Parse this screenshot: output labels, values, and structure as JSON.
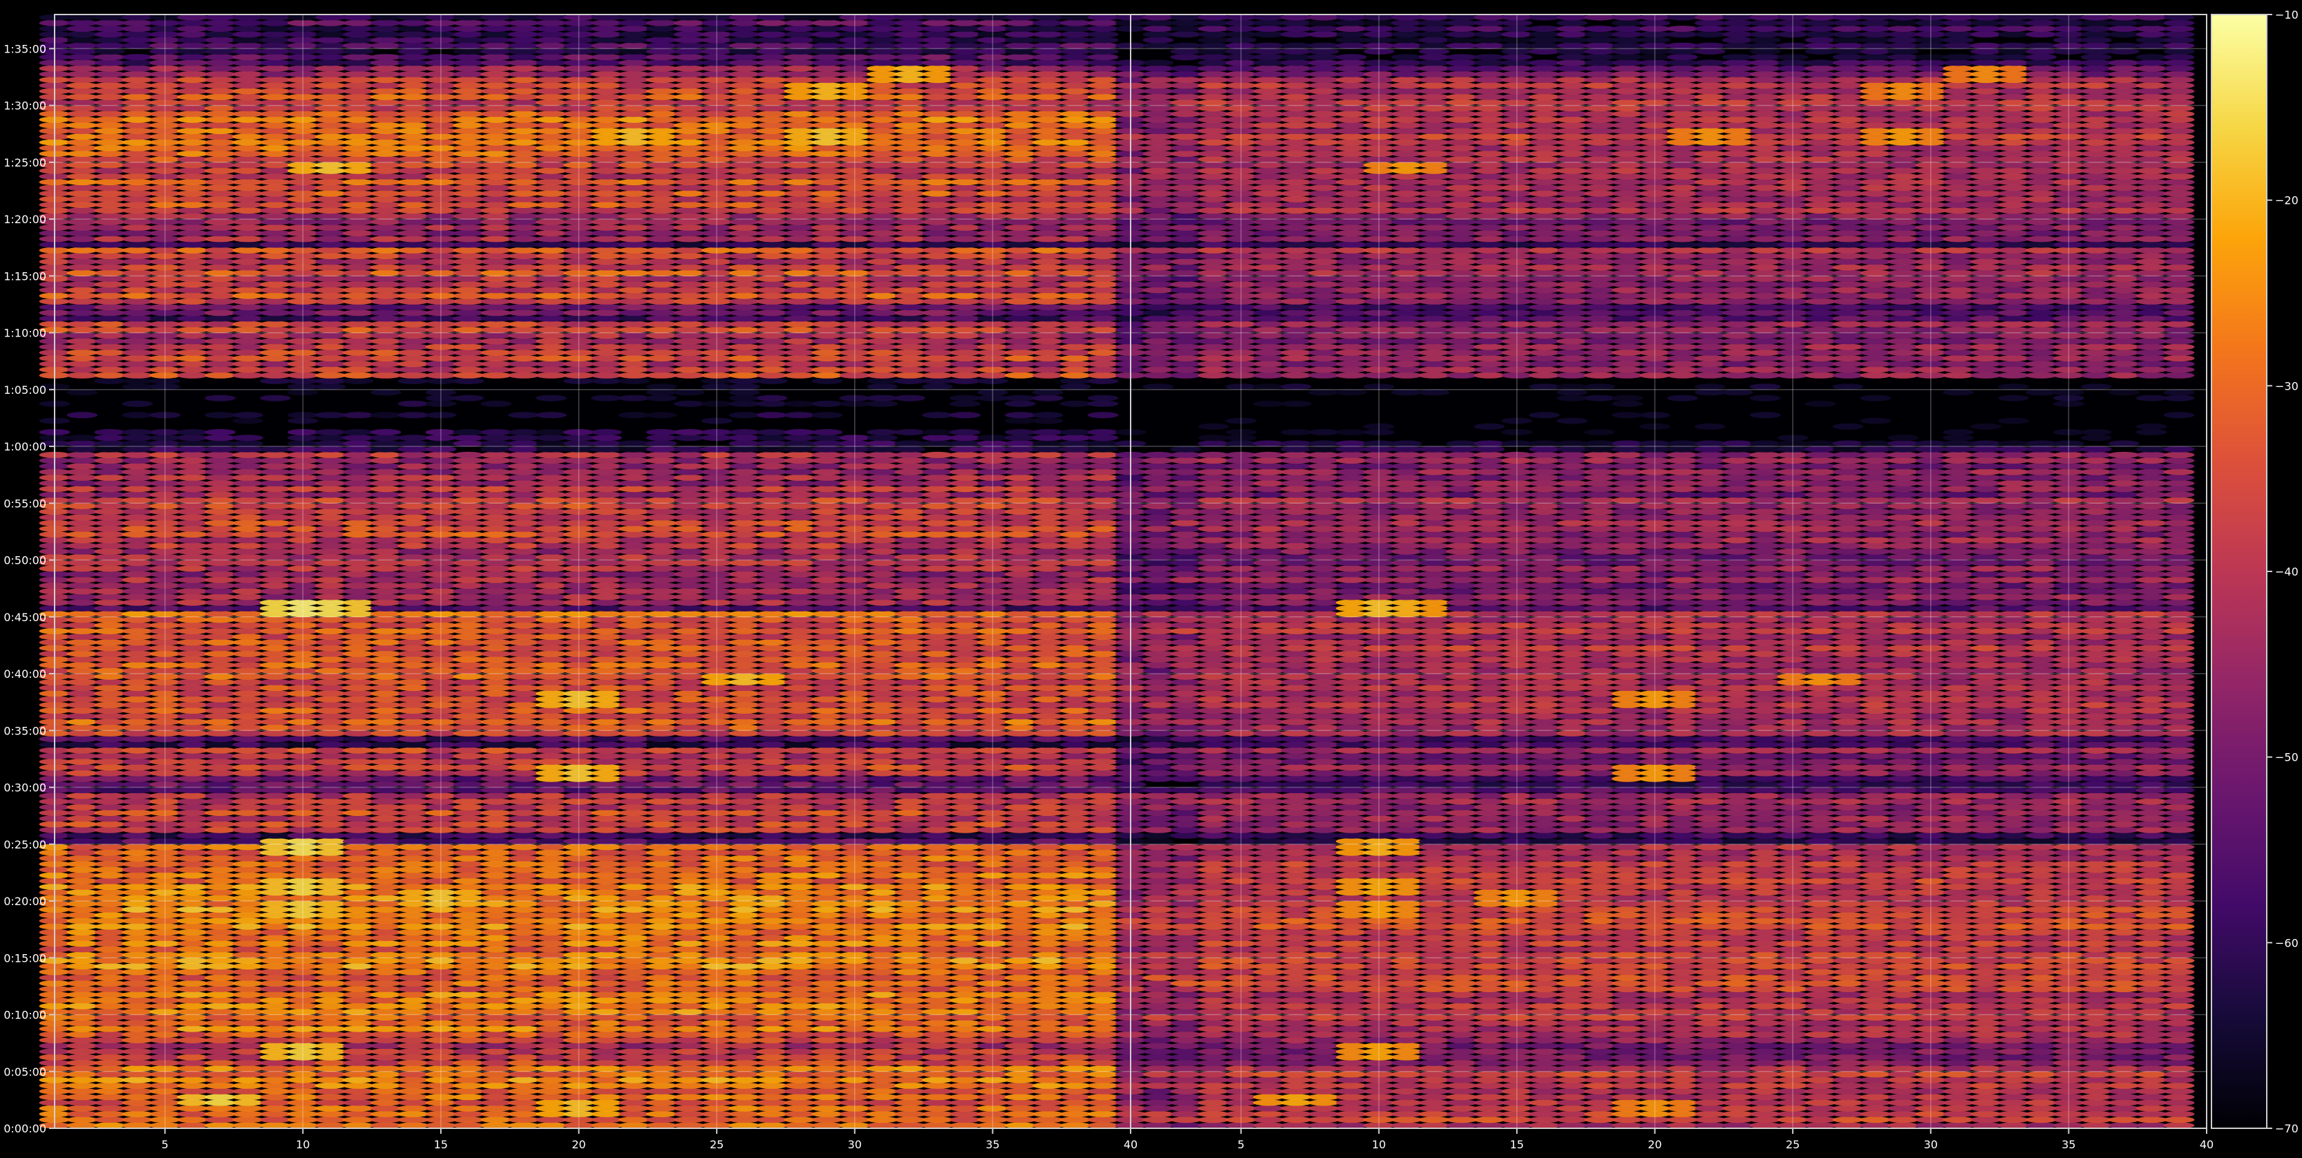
{
  "chart_data": {
    "type": "heatmap",
    "title": "",
    "xlabel": "",
    "ylabel": "",
    "colormap": "inferno",
    "background": "#000000",
    "grid": true,
    "panels": [
      {
        "name": "",
        "xlim": [
          1,
          40
        ],
        "xticks": [
          5,
          10,
          15,
          20,
          25,
          30,
          35,
          40
        ],
        "xticklabels": [
          "5",
          "10",
          "15",
          "20",
          "25",
          "30",
          "35",
          "40"
        ],
        "channel_range": [
          1,
          39
        ],
        "brightness": 1.0
      },
      {
        "name": "",
        "xlim": [
          1,
          40
        ],
        "xticks": [
          5,
          10,
          15,
          20,
          25,
          30,
          35,
          40
        ],
        "xticklabels": [
          "5",
          "10",
          "15",
          "20",
          "25",
          "30",
          "35",
          "40"
        ],
        "channel_range": [
          1,
          39
        ],
        "brightness": 0.78
      }
    ],
    "y_time_seconds_range": [
      0,
      5880
    ],
    "yticks_seconds": [
      0,
      300,
      600,
      900,
      1200,
      1500,
      1800,
      2100,
      2400,
      2700,
      3000,
      3300,
      3600,
      3900,
      4200,
      4500,
      4800,
      5100,
      5400,
      5700
    ],
    "yticklabels": [
      "0:00:00",
      "0:05:00",
      "0:10:00",
      "0:15:00",
      "0:20:00",
      "0:25:00",
      "0:30:00",
      "0:35:00",
      "0:40:00",
      "0:45:00",
      "0:50:00",
      "0:55:00",
      "1:00:00",
      "1:05:00",
      "1:10:00",
      "1:15:00",
      "1:20:00",
      "1:25:00",
      "1:30:00",
      "1:35:00"
    ],
    "colorbar": {
      "range": [
        -70,
        -10
      ],
      "ticks": [
        -10,
        -20,
        -30,
        -40,
        -50,
        -60,
        -70
      ],
      "ticklabels": [
        "−10",
        "−20",
        "−30",
        "−40",
        "−50",
        "−60",
        "−70"
      ],
      "label": ""
    },
    "bands": [
      {
        "t0": 0,
        "t1": 330,
        "level": -30
      },
      {
        "t0": 330,
        "t1": 490,
        "level": -40
      },
      {
        "t0": 490,
        "t1": 720,
        "level": -30
      },
      {
        "t0": 720,
        "t1": 1050,
        "level": -28
      },
      {
        "t0": 1050,
        "t1": 1350,
        "level": -27
      },
      {
        "t0": 1350,
        "t1": 1490,
        "level": -32
      },
      {
        "t0": 1490,
        "t1": 1560,
        "level": -55
      },
      {
        "t0": 1560,
        "t1": 1780,
        "level": -38
      },
      {
        "t0": 1780,
        "t1": 1860,
        "level": -55
      },
      {
        "t0": 1860,
        "t1": 2020,
        "level": -40
      },
      {
        "t0": 2020,
        "t1": 2080,
        "level": -56
      },
      {
        "t0": 2080,
        "t1": 2400,
        "level": -34
      },
      {
        "t0": 2400,
        "t1": 2720,
        "level": -32
      },
      {
        "t0": 2720,
        "t1": 2760,
        "level": -56
      },
      {
        "t0": 2760,
        "t1": 3080,
        "level": -42
      },
      {
        "t0": 3080,
        "t1": 3340,
        "level": -38
      },
      {
        "t0": 3340,
        "t1": 3580,
        "level": -42
      },
      {
        "t0": 3580,
        "t1": 3640,
        "level": -60
      },
      {
        "t0": 3640,
        "t1": 3700,
        "level": -66
      },
      {
        "t0": 3700,
        "t1": 3950,
        "level": -70
      },
      {
        "t0": 3950,
        "t1": 4270,
        "level": -38
      },
      {
        "t0": 4270,
        "t1": 4350,
        "level": -55
      },
      {
        "t0": 4350,
        "t1": 4640,
        "level": -36
      },
      {
        "t0": 4640,
        "t1": 4690,
        "level": -55
      },
      {
        "t0": 4690,
        "t1": 4830,
        "level": -44
      },
      {
        "t0": 4830,
        "t1": 5080,
        "level": -34
      },
      {
        "t0": 5080,
        "t1": 5340,
        "level": -31
      },
      {
        "t0": 5340,
        "t1": 5540,
        "level": -35
      },
      {
        "t0": 5540,
        "t1": 5620,
        "level": -44
      },
      {
        "t0": 5620,
        "t1": 5880,
        "level": -58
      }
    ],
    "hotspots": [
      {
        "ch": 10,
        "t": 2750,
        "level": -13
      },
      {
        "ch": 11,
        "t": 2750,
        "level": -15
      },
      {
        "ch": 10,
        "t": 1490,
        "level": -15
      },
      {
        "ch": 7,
        "t": 150,
        "level": -16
      },
      {
        "ch": 10,
        "t": 1150,
        "level": -17
      },
      {
        "ch": 10,
        "t": 1280,
        "level": -16
      },
      {
        "ch": 15,
        "t": 1220,
        "level": -18
      },
      {
        "ch": 10,
        "t": 400,
        "level": -17
      },
      {
        "ch": 29,
        "t": 5240,
        "level": -18
      },
      {
        "ch": 11,
        "t": 5070,
        "level": -18
      },
      {
        "ch": 20,
        "t": 1880,
        "level": -18
      },
      {
        "ch": 20,
        "t": 2270,
        "level": -18
      },
      {
        "ch": 29,
        "t": 5480,
        "level": -20
      },
      {
        "ch": 22,
        "t": 5230,
        "level": -19
      },
      {
        "ch": 26,
        "t": 2370,
        "level": -19
      },
      {
        "ch": 32,
        "t": 5560,
        "level": -20
      },
      {
        "ch": 20,
        "t": 110,
        "level": -19
      }
    ]
  }
}
